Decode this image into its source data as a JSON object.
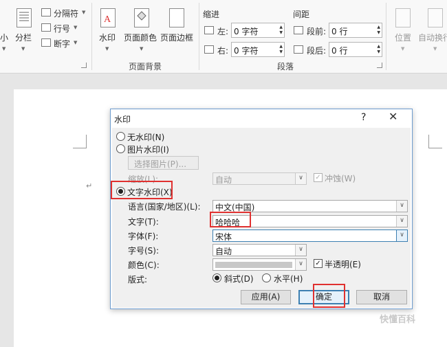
{
  "ribbon": {
    "partial_left": "小",
    "columns": "分栏",
    "breaks": "分隔符",
    "line_numbers": "行号",
    "hyphenation": "断字",
    "watermark": "水印",
    "page_color": "页面颜色",
    "page_borders": "页面边框",
    "page_background_label": "页面背景",
    "indent": {
      "title": "缩进",
      "left_label": "左:",
      "left_value": "0 字符",
      "right_label": "右:",
      "right_value": "0 字符"
    },
    "spacing": {
      "title": "间距",
      "before_label": "段前:",
      "before_value": "0 行",
      "after_label": "段后:",
      "after_value": "0 行"
    },
    "paragraph_label": "段落",
    "position": "位置",
    "wrap_text": "自动换行"
  },
  "dialog": {
    "title": "水印",
    "help": "?",
    "close": "✕",
    "no_watermark": "无水印(N)",
    "picture_watermark": "图片水印(I)",
    "select_picture": "选择图片(P)...",
    "scale_label": "缩放(L):",
    "scale_value": "自动",
    "washout": "冲蚀(W)",
    "text_watermark": "文字水印(X)",
    "language_label": "语言(国家/地区)(L):",
    "language_value": "中文(中国)",
    "text_label": "文字(T):",
    "text_value": "哈哈哈",
    "font_label": "字体(F):",
    "font_value": "宋体",
    "size_label": "字号(S):",
    "size_value": "自动",
    "color_label": "颜色(C):",
    "semitransparent": "半透明(E)",
    "layout_label": "版式:",
    "diagonal": "斜式(D)",
    "horizontal": "水平(H)",
    "apply": "应用(A)",
    "ok": "确定",
    "cancel": "取消"
  },
  "watermark_text": "快懂百科",
  "colors": {
    "highlight": "#e0302f",
    "accent": "#3c7fb1"
  }
}
